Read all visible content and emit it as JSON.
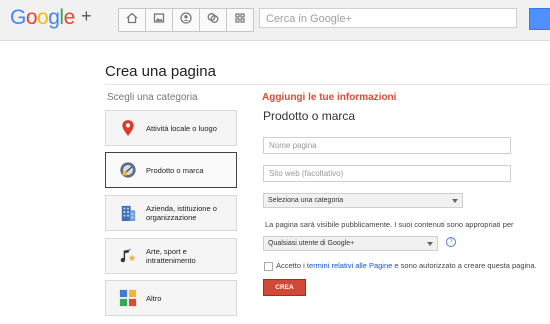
{
  "app": {
    "logo_text": "Google",
    "logo_plus": "+"
  },
  "nav": {
    "buttons": [
      "home-icon",
      "photos-icon",
      "profile-icon",
      "circles-icon",
      "games-icon"
    ],
    "search_placeholder": "Cerca in Google+"
  },
  "page": {
    "title": "Crea una pagina"
  },
  "categories": {
    "header": "Scegli una categoria",
    "items": [
      {
        "label": "Attività locale o luogo",
        "icon": "map-pin-icon",
        "selected": false
      },
      {
        "label": "Prodotto o marca",
        "icon": "product-icon",
        "selected": true
      },
      {
        "label": "Azienda, istituzione o organizzazione",
        "icon": "building-icon",
        "selected": false
      },
      {
        "label": "Arte, sport e intrattenimento",
        "icon": "music-star-icon",
        "selected": false
      },
      {
        "label": "Altro",
        "icon": "other-icon",
        "selected": false
      }
    ]
  },
  "form": {
    "header": "Aggiungi le tue informazioni",
    "subheader": "Prodotto o marca",
    "name_placeholder": "Nome pagina",
    "website_placeholder": "Sito web (facoltativo)",
    "category_select": "Seleziona una categoria",
    "visibility_note": "La pagina sarà visibile pubblicamente. I suoi contenuti sono appropriati per",
    "audience_select": "Qualsiasi utente di Google+",
    "help_symbol": "?",
    "terms_prefix": "Accetto i ",
    "terms_link": "termini relativi alle Pagine",
    "terms_suffix": " e sono autorizzato a creare questa pagina.",
    "create_button": "CREA"
  },
  "colors": {
    "accent_red": "#dd4b39",
    "button_red": "#d14836",
    "link_blue": "#1155cc",
    "search_blue": "#4d90fe"
  }
}
